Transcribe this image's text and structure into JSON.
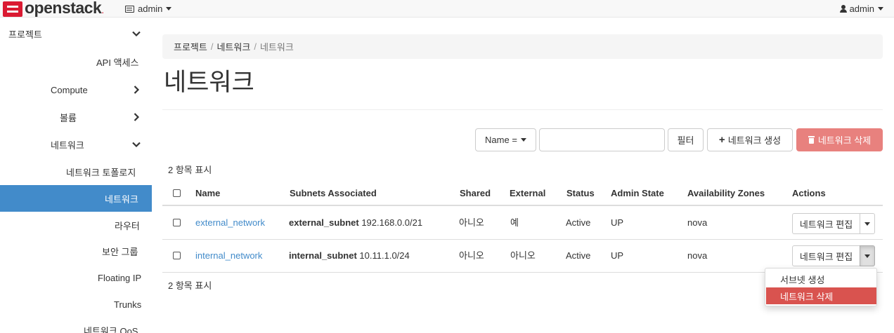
{
  "navbar": {
    "brand": "openstack",
    "brand_suffix": ".",
    "project_label": "admin",
    "user_label": "admin"
  },
  "sidebar": {
    "items": [
      {
        "label": "프로젝트",
        "chevron": "down"
      },
      {
        "label": "API 액세스"
      },
      {
        "label": "Compute",
        "chevron": "right"
      },
      {
        "label": "볼륨",
        "chevron": "right"
      },
      {
        "label": "네트워크",
        "chevron": "down"
      },
      {
        "label": "네트워크 토폴로지"
      },
      {
        "label": "네트워크",
        "active": true
      },
      {
        "label": "라우터"
      },
      {
        "label": "보안 그룹"
      },
      {
        "label": "Floating IP"
      },
      {
        "label": "Trunks"
      },
      {
        "label": "네트워크 QoS"
      }
    ]
  },
  "breadcrumb": [
    "프로젝트",
    "네트워크",
    "네트워크"
  ],
  "page_title": "네트워크",
  "toolbar": {
    "filter_field": "Name =",
    "filter_value": "",
    "filter_button": "필터",
    "create_button": "네트워크 생성",
    "delete_button": "네트워크 삭제"
  },
  "count_text": "2 항목 표시",
  "table": {
    "columns": [
      "Name",
      "Subnets Associated",
      "Shared",
      "External",
      "Status",
      "Admin State",
      "Availability Zones",
      "Actions"
    ],
    "rows": [
      {
        "name": "external_network",
        "subnet_name": "external_subnet",
        "subnet_cidr": "192.168.0.0/21",
        "shared": "아니오",
        "external": "예",
        "status": "Active",
        "admin_state": "UP",
        "zones": "nova",
        "action": "네트워크 편집"
      },
      {
        "name": "internal_network",
        "subnet_name": "internal_subnet",
        "subnet_cidr": "10.11.1.0/24",
        "shared": "아니오",
        "external": "아니오",
        "status": "Active",
        "admin_state": "UP",
        "zones": "nova",
        "action": "네트워크 편집"
      }
    ]
  },
  "row_menu": {
    "items": [
      "서브넷 생성",
      "네트워크 삭제"
    ]
  },
  "colors": {
    "brand_red": "#da1a32",
    "active_blue": "#428bca",
    "danger": "#d9534f",
    "danger_disabled": "#e8817e"
  },
  "icons": {
    "project": "project-icon",
    "user": "user-icon",
    "plus": "plus-icon",
    "trash": "trash-icon"
  }
}
